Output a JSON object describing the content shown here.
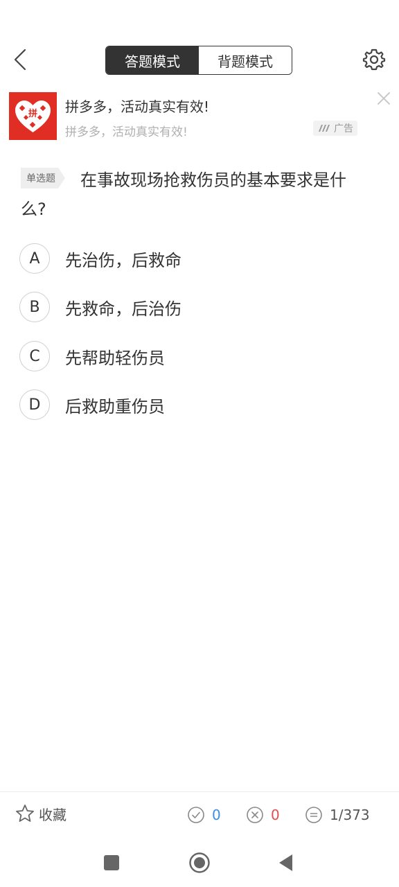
{
  "header": {
    "tabs": [
      {
        "label": "答题模式",
        "active": true
      },
      {
        "label": "背题模式",
        "active": false
      }
    ]
  },
  "ad": {
    "logo_text": "拼",
    "title": "拼多多，活动真实有效!",
    "subtitle": "拼多多，活动真实有效!",
    "badge": "广告"
  },
  "question": {
    "type_tag": "单选题",
    "text_line1": "在事故现场抢救伤员的基本要求是什",
    "text_line2": "么?",
    "options": [
      {
        "letter": "A",
        "text": "先治伤，后救命"
      },
      {
        "letter": "B",
        "text": "先救命，后治伤"
      },
      {
        "letter": "C",
        "text": "先帮助轻伤员"
      },
      {
        "letter": "D",
        "text": "后救助重伤员"
      }
    ]
  },
  "bottom": {
    "favorite_label": "收藏",
    "correct_count": "0",
    "wrong_count": "0",
    "progress": "1/373"
  },
  "colors": {
    "accent_dark": "#333333",
    "ad_red": "#e02e24",
    "correct_blue": "#3a8ee6",
    "wrong_red": "#e05050"
  }
}
